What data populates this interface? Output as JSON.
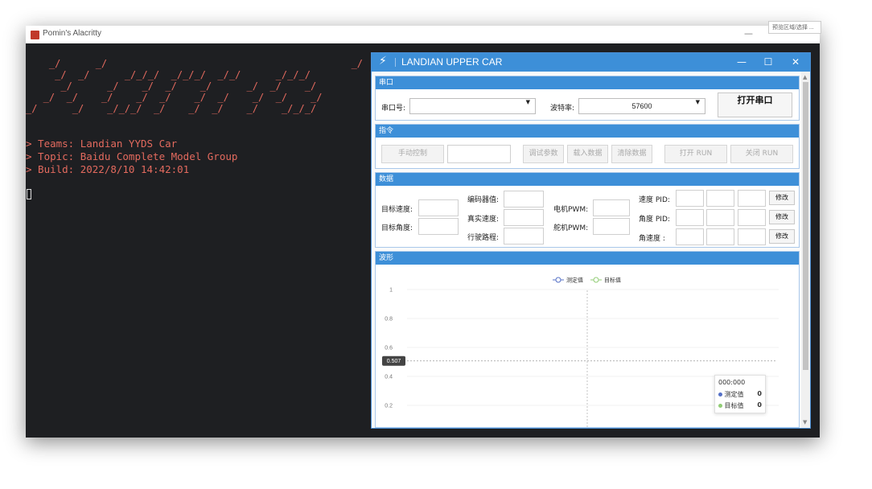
{
  "terminal": {
    "title": "Pomin's Alacritty",
    "minimize_glyph": "—",
    "ascii_art": "    _/      _/                                          _/\n     _/  _/      _/_/_/  _/_/_/  _/_/      _/_/_/\n      _/      _/    _/  _/    _/      _/  _/    _/\n   _/  _/    _/    _/  _/    _/  _/    _/  _/    _/\n_/      _/    _/_/_/  _/    _/  _/    _/    _/_/_/",
    "lines": [
      "> Teams: Landian YYDS Car",
      "> Topic: Baidu Complete Model Group",
      "> Build: 2022/8/10 14:42:01"
    ]
  },
  "other_window": {
    "clipped_text": "预览区域/选择 ..."
  },
  "app": {
    "title": "LANDIAN UPPER CAR",
    "window_buttons": {
      "minimize": "—",
      "maximize": "☐",
      "close": "✕"
    },
    "serial": {
      "header": "串口",
      "port_label": "串口号:",
      "port_value": "",
      "baud_label": "波特率:",
      "baud_value": "57600",
      "open_button": "打开串口"
    },
    "commands": {
      "header": "指令",
      "manual": "手动控制",
      "tune": "调试参数",
      "load": "载入数据",
      "clear": "清除数据",
      "run_on": "打开 RUN",
      "run_off": "关闭 RUN"
    },
    "data": {
      "header": "数据",
      "target_speed": "目标速度:",
      "target_angle": "目标角度:",
      "encoder": "编码器值:",
      "real_speed": "真实速度:",
      "distance": "行驶路程:",
      "motor_pwm": "电机PWM:",
      "servo_pwm": "舵机PWM:",
      "speed_pid": "速度 PID:",
      "angle_pid": "角度 PID:",
      "angular_speed": "角速度  :",
      "modify": "修改"
    },
    "waveform": {
      "header": "波形",
      "tooltip_time": "000:000",
      "crosshair_value": "0.507"
    }
  },
  "chart_data": {
    "type": "line",
    "series": [
      {
        "name": "测定值",
        "values": [],
        "color": "#5470c6"
      },
      {
        "name": "目标值",
        "values": [],
        "color": "#91cc75"
      }
    ],
    "yticks": [
      "1",
      "0.8",
      "0.6",
      "0.4",
      "0.2"
    ],
    "ylim": [
      0,
      1
    ],
    "legend_position": "top-center",
    "grid": true,
    "tooltip": {
      "time": "000:000",
      "rows": [
        {
          "name": "测定值",
          "value": "0"
        },
        {
          "name": "目标值",
          "value": "0"
        }
      ]
    },
    "crosshair_y": 0.507
  }
}
